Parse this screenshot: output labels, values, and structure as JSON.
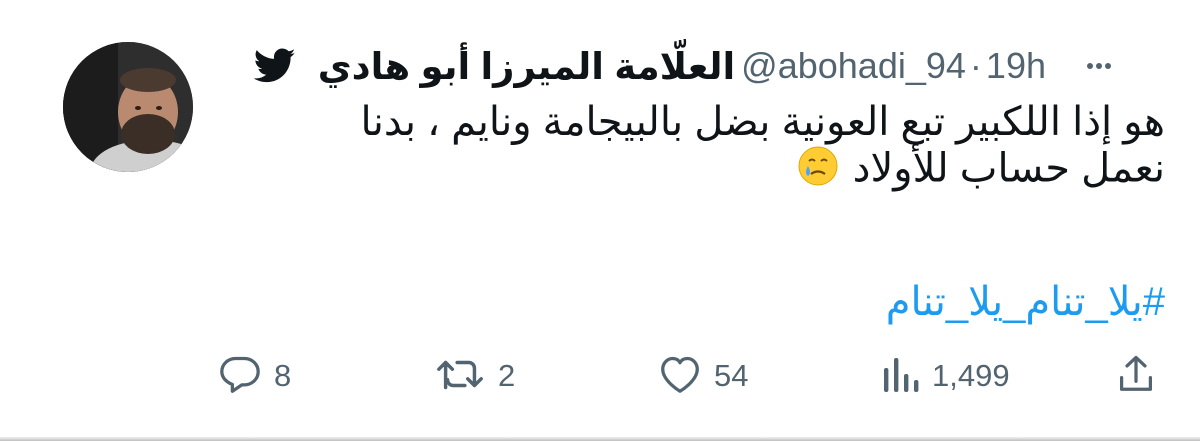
{
  "tweet": {
    "display_name": "العلّامة الميرزا أبو هادي",
    "handle": "@abohadi_94",
    "separator": "·",
    "time": "19h",
    "text_line1": "هو إذا اللكبير تبع العونية بضل بالبيجامة ونايم ، بدنا",
    "text_line2": "نعمل حساب للأولاد",
    "emoji": "face-holding-back-tears",
    "hashtag": "#يلا_تنام_يلا_تنام"
  },
  "actions": {
    "replies": "8",
    "retweets": "2",
    "likes": "54",
    "views": "1,499"
  },
  "icons": {
    "brand": "twitter-bird-icon",
    "more": "more-icon",
    "reply": "reply-icon",
    "retweet": "retweet-icon",
    "like": "heart-icon",
    "views": "views-chart-icon",
    "share": "share-icon"
  },
  "colors": {
    "link": "#1d9bf0",
    "muted": "#536471",
    "text": "#0f1419"
  }
}
